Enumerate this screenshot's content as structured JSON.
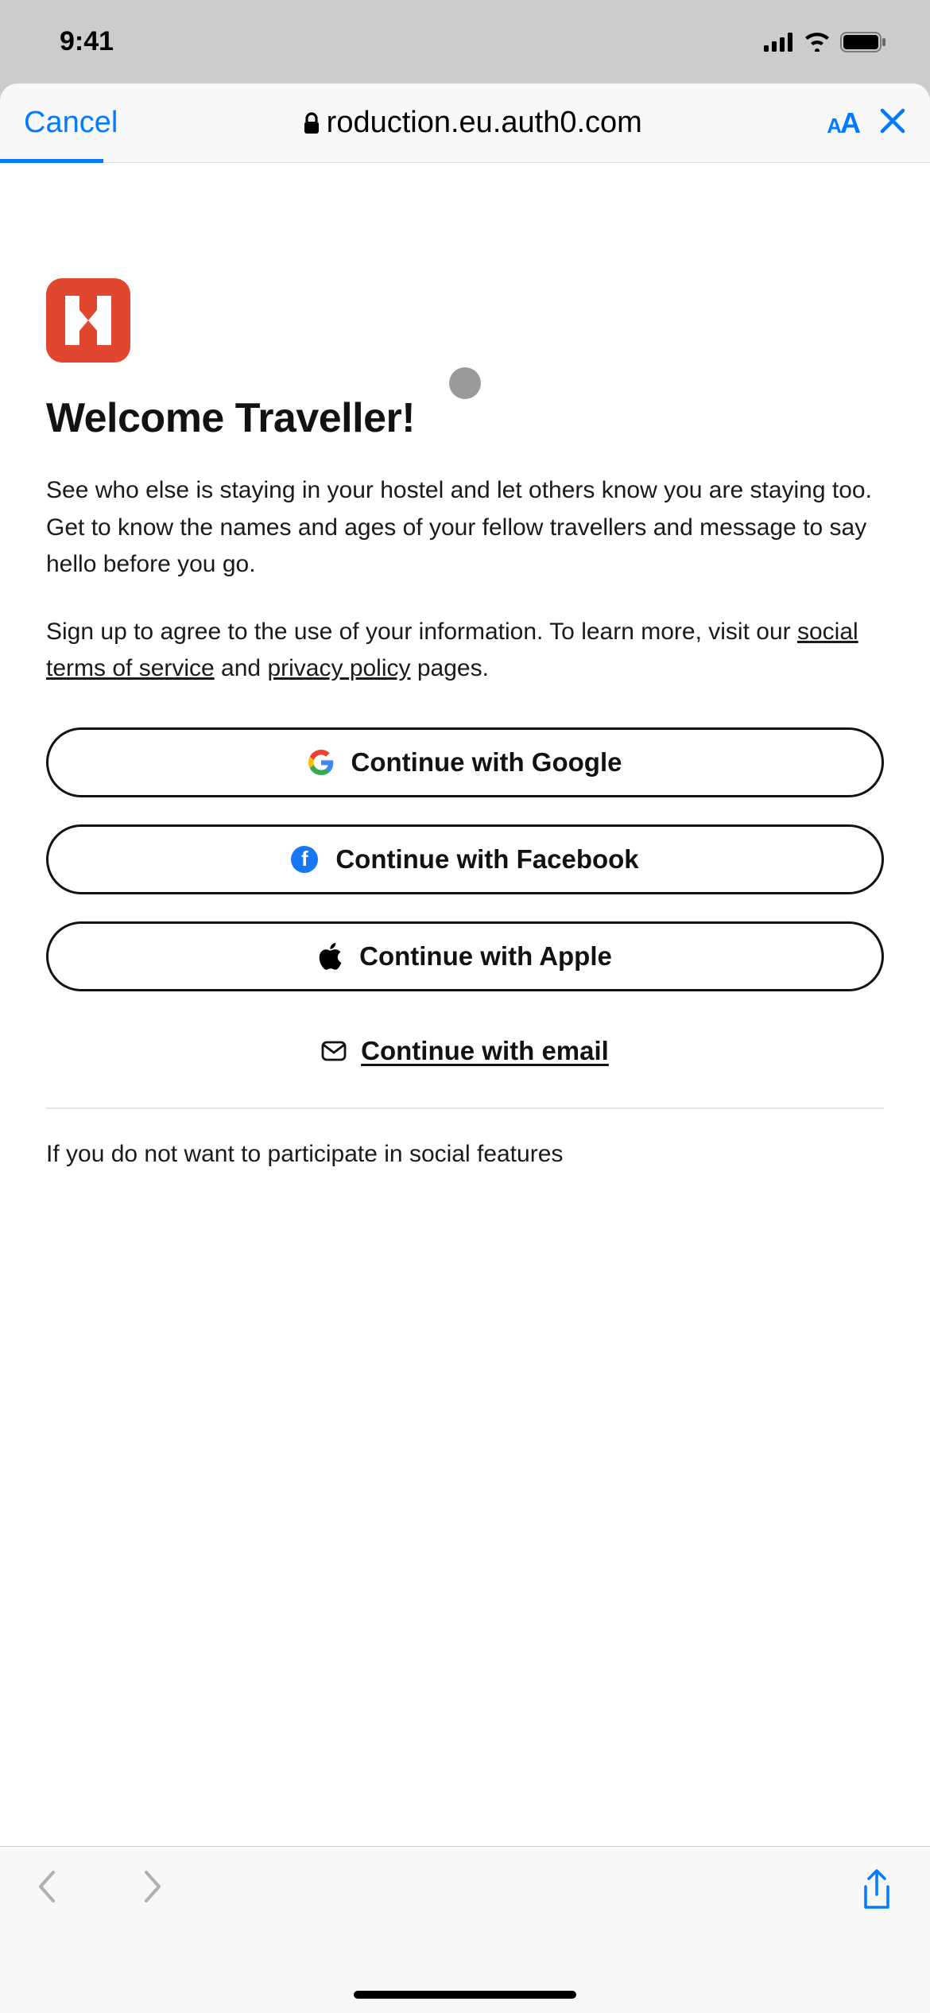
{
  "status": {
    "time": "9:41"
  },
  "browser": {
    "cancel_label": "Cancel",
    "url": "roduction.eu.auth0.com"
  },
  "page": {
    "title": "Welcome Traveller!",
    "description": "See who else is staying in your hostel and let others know you are staying too. Get to know the names and ages of your fellow travellers and message to say hello before you go.",
    "terms_prefix": "Sign up to agree to the use of your information. To learn more, visit our ",
    "terms_link": "social terms of service",
    "terms_mid": " and ",
    "privacy_link": "privacy policy",
    "terms_suffix": " pages.",
    "buttons": {
      "google": "Continue with Google",
      "facebook": "Continue with Facebook",
      "apple": "Continue with Apple",
      "email": "Continue with email"
    },
    "footer_partial": "If you do not want to participate in social features"
  }
}
